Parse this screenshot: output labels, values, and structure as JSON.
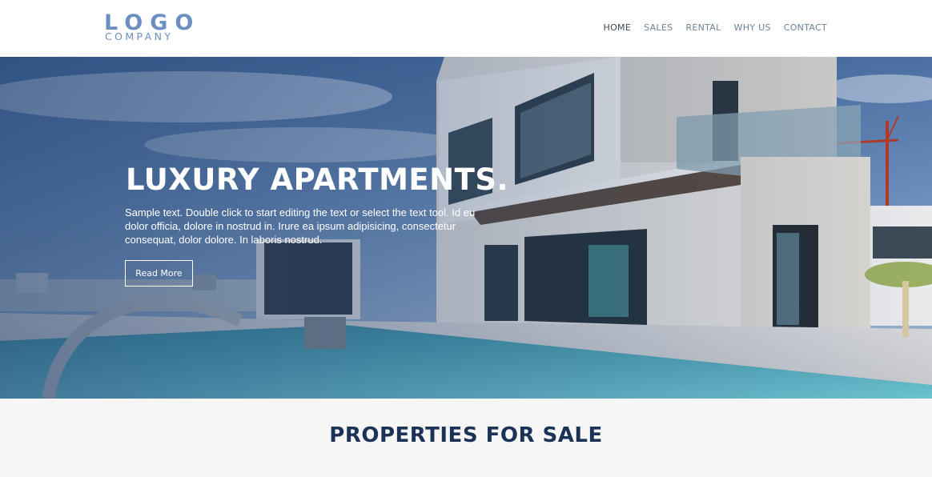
{
  "logo": {
    "main": "LOGO",
    "sub": "COMPANY",
    "color": "#6b8fc0"
  },
  "nav": {
    "items": [
      {
        "label": "HOME",
        "active": true
      },
      {
        "label": "SALES"
      },
      {
        "label": "RENTAL"
      },
      {
        "label": "WHY US"
      },
      {
        "label": "CONTACT"
      }
    ]
  },
  "hero": {
    "title": "LUXURY APARTMENTS.",
    "text": "Sample text. Double click to start editing the text or select the text tool. Id eu dolor officia, dolore in nostrud in. Irure ea ipsum adipisicing, consectetur consequat, dolor dolore. In laboris nostrud.",
    "button_label": "Read More"
  },
  "section": {
    "title": "PROPERTIES FOR SALE",
    "color": "#1c3357"
  }
}
